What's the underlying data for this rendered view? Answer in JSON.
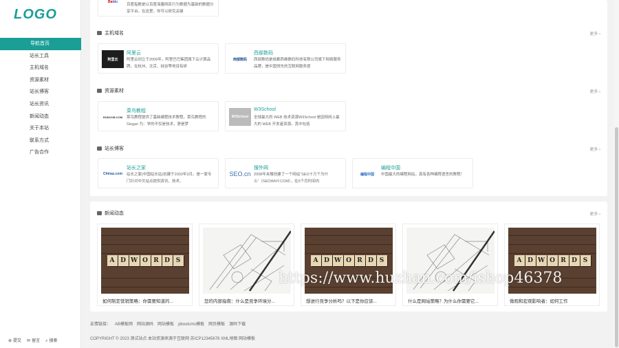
{
  "brand": {
    "logo": "LOGO",
    "accent": "#1a9e96"
  },
  "nav": {
    "items": [
      {
        "label": "导航首页",
        "active": true
      },
      {
        "label": "站长工具"
      },
      {
        "label": "主机域名"
      },
      {
        "label": "资源素材"
      },
      {
        "label": "站长博客"
      },
      {
        "label": "站长资讯"
      },
      {
        "label": "新闻动态"
      },
      {
        "label": "关于本站"
      },
      {
        "label": "联系方式"
      },
      {
        "label": "广告合作"
      }
    ]
  },
  "sidebar_bottom": {
    "submit": "提交",
    "message": "留言",
    "search": "搜索"
  },
  "top_card": {
    "desc": "百度指数是以百度海量网民行为数据为基础的数据分享平台。在这里，你可以研究关键"
  },
  "sections": [
    {
      "title": "主机域名",
      "more": "更多",
      "cards": [
        {
          "title": "阿里云",
          "logo_text": "阿里云",
          "desc": "阿里云创立于2009年，阿里巴巴集团旗下云计算品牌，在杭州、北京、硅谷等地设有研"
        },
        {
          "title": "西部数码",
          "logo_text": "西部数码",
          "desc": "西部数码是成都西维数码科技有限公司旗下网络服务品牌，是中国领先的互联网服务提"
        }
      ]
    },
    {
      "title": "资源素材",
      "more": "更多",
      "cards": [
        {
          "title": "菜鸟教程",
          "logo_text": "RUNOOB.COM",
          "desc": "菜鸟教程提供了基础编程技术教程。菜鸟教程的 Slogan 为：学的不仅是技术，更是梦"
        },
        {
          "title": "W3School",
          "logo_text": "W3School",
          "desc": "全球最大的 WEB 技术资源W3School 是因特网上最大的 WEB 开发者资源。其中包括"
        }
      ]
    },
    {
      "title": "站长博客",
      "more": "更多",
      "cards": [
        {
          "title": "站长之家",
          "logo_text": "Chinaz.com",
          "desc": "站长之家(中国站长站)创建于2002年3月。是一家专门针对中文站点提供资讯、技术、"
        },
        {
          "title": "搜外网",
          "logo_text": "SEO.cn",
          "desc": "2008年夹楼创建了一个网站“SEO十万个为什么”（SEOWHY.COM），在5个月时间内"
        },
        {
          "title": "编程中国",
          "logo_text": "编程中国",
          "desc": "中国最大的编程网站，真有各种编程语言的教程！"
        }
      ]
    }
  ],
  "news": {
    "title": "新闻动态",
    "more": "更多",
    "items": [
      {
        "caption": "如何制定营销策略：你需要知道的...",
        "image": "adwords"
      },
      {
        "caption": "您的内部指南：什么是竞争环境分...",
        "image": "sketch"
      },
      {
        "caption": "想进行竞争分析吗？以下是你应该...",
        "image": "adwords"
      },
      {
        "caption": "什么是网站策略？为什么你需要它...",
        "image": "sketch"
      },
      {
        "caption": "微观和宏观影响者：如何工作",
        "image": "adwords"
      }
    ],
    "tile_letters": [
      "A",
      "D",
      "W",
      "O",
      "R",
      "D",
      "S"
    ]
  },
  "footer": {
    "links_label": "友情链接：",
    "links": [
      "AB模板网",
      "网站源码",
      "网站模板",
      "pbootcms模板",
      "网页模板",
      "源码下载"
    ],
    "copyright": "COPYRIGHT © 2023 测试站点 本站资源来源于互联网 苏ICP12345678 XML地图 网站模板"
  },
  "watermark": "https://www.huzhan.com/ishop46378"
}
